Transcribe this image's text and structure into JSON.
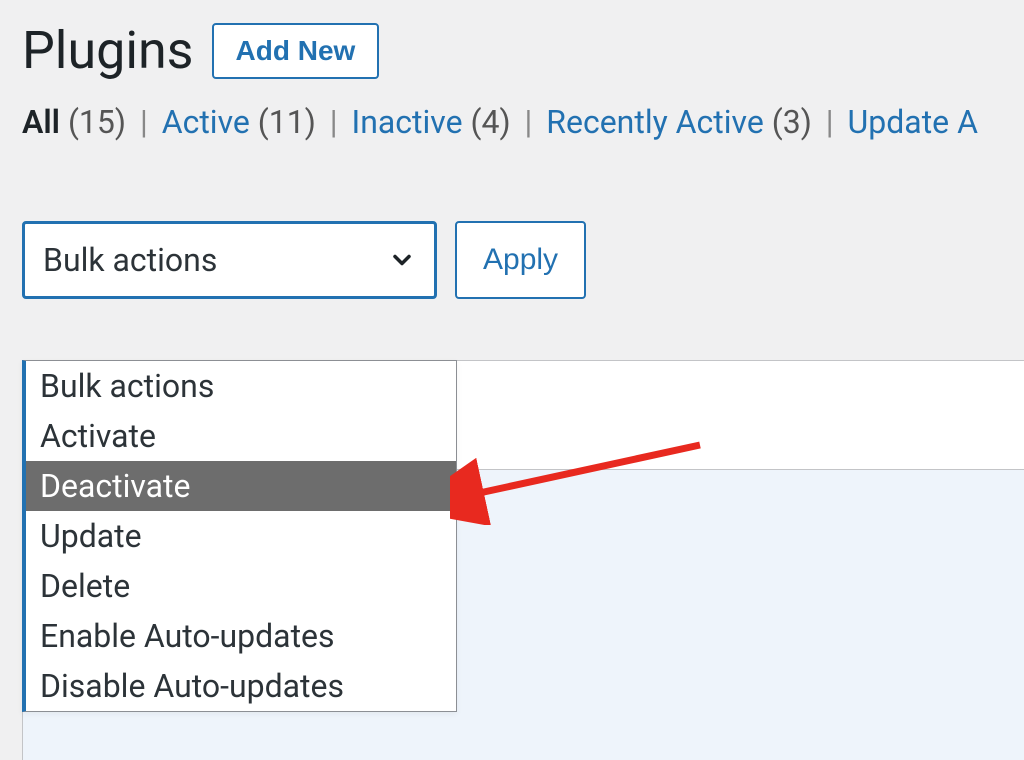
{
  "header": {
    "title": "Plugins",
    "add_new_label": "Add New"
  },
  "filters": {
    "all": {
      "label": "All",
      "count": "(15)"
    },
    "active": {
      "label": "Active",
      "count": "(11)"
    },
    "inactive": {
      "label": "Inactive",
      "count": "(4)"
    },
    "recently_active": {
      "label": "Recently Active",
      "count": "(3)"
    },
    "update": {
      "label": "Update A"
    },
    "separator": " | "
  },
  "bulk": {
    "selected_label": "Bulk actions",
    "apply_label": "Apply",
    "options": [
      "Bulk actions",
      "Activate",
      "Deactivate",
      "Update",
      "Delete",
      "Enable Auto-updates",
      "Disable Auto-updates"
    ],
    "highlighted_index": 2
  }
}
